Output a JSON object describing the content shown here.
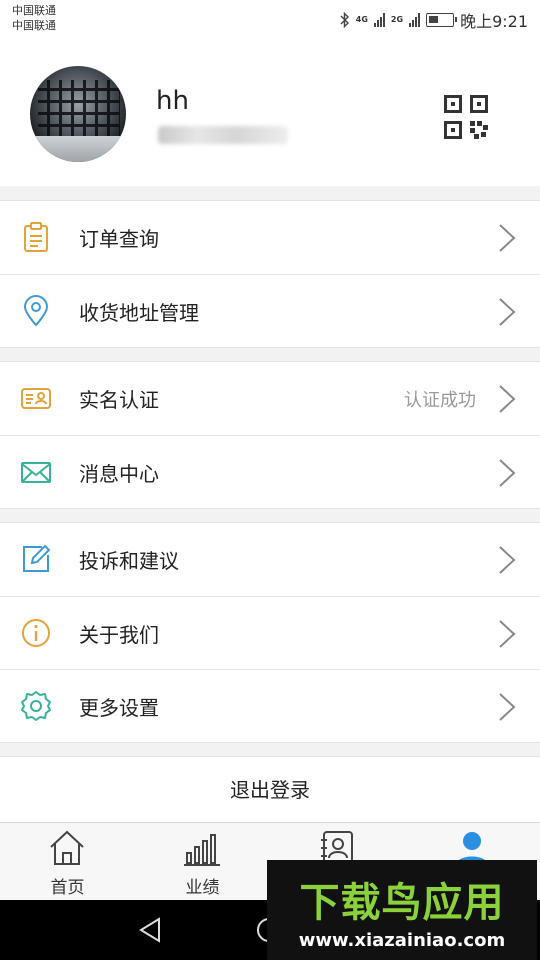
{
  "status_bar": {
    "carrier_1": "中国联通",
    "carrier_2": "中国联通",
    "network_1": "4G",
    "network_2": "2G",
    "time": "晚上9:21",
    "bluetooth_icon": "bluetooth-icon",
    "battery_level": 0.4
  },
  "profile": {
    "username": "hh",
    "phone": "1",
    "qr_icon": "qr-code-icon"
  },
  "menu_groups": [
    [
      {
        "label": "订单查询",
        "icon": "order-icon",
        "value": ""
      },
      {
        "label": "收货地址管理",
        "icon": "location-icon",
        "value": ""
      }
    ],
    [
      {
        "label": "实名认证",
        "icon": "id-card-icon",
        "value": "认证成功"
      },
      {
        "label": "消息中心",
        "icon": "mail-icon",
        "value": ""
      }
    ],
    [
      {
        "label": "投诉和建议",
        "icon": "edit-icon",
        "value": ""
      },
      {
        "label": "关于我们",
        "icon": "info-icon",
        "value": ""
      },
      {
        "label": "更多设置",
        "icon": "gear-icon",
        "value": ""
      }
    ]
  ],
  "logout_label": "退出登录",
  "tabs": [
    {
      "label": "首页",
      "icon": "home-icon"
    },
    {
      "label": "业绩",
      "icon": "bar-chart-icon"
    },
    {
      "label": "",
      "icon": "contacts-icon"
    },
    {
      "label": "",
      "icon": "user-icon"
    }
  ],
  "watermark": {
    "title": "下载鸟应用",
    "url": "www.xiazainiao.com"
  },
  "colors": {
    "icon_orange": "#e5a13a",
    "icon_blue": "#3e9bd4",
    "icon_teal": "#36b29a",
    "tab_active": "#2a8fe0"
  }
}
